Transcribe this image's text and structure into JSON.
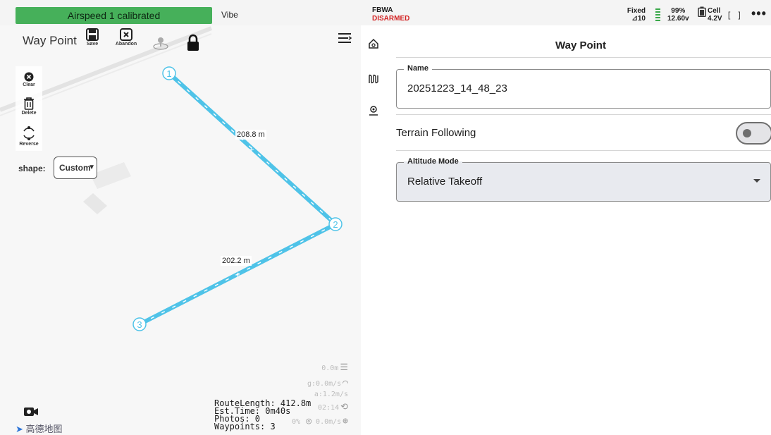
{
  "status": {
    "message": "Airspeed 1 calibrated",
    "vibe_label": "Vibe",
    "flight_mode": "FBWA",
    "arm_state": "DISARMED",
    "gps_fix": "Fixed",
    "gps_sats": "⊿10",
    "battery_percent": "99%",
    "battery_voltage": "12.60v",
    "cell_label": "Cell",
    "cell_voltage": "4.2V",
    "accent_color": "#46b05a",
    "alert_color": "#d22020"
  },
  "map": {
    "title": "Way Point",
    "toolbar": {
      "save_label": "Save",
      "abandon_label": "Abandon"
    },
    "side_tools": {
      "clear_label": "Clear",
      "delete_label": "Delete",
      "reverse_label": "Reverse"
    },
    "shape": {
      "label": "shape:",
      "value": "Custom"
    },
    "waypoints": [
      {
        "label": "1"
      },
      {
        "label": "2"
      },
      {
        "label": "3"
      }
    ],
    "segments": [
      {
        "distance": "208.8 m"
      },
      {
        "distance": "202.2 m"
      }
    ],
    "route_stats": {
      "route_length": "RouteLength: 412.8m",
      "est_time": "Est.Time: 0m40s",
      "photos": "Photos: 0",
      "waypoints": "Waypoints: 3"
    },
    "telemetry": {
      "altitude": "0.0m",
      "ground_speed": "g:0.0m/s",
      "air_speed": "a:1.2m/s",
      "clock": "02:14",
      "throttle": "0%",
      "climb": "0.0m/s"
    },
    "logo_text": "高德地图",
    "route_color": "#4fc3e8"
  },
  "form": {
    "title": "Way Point",
    "name": {
      "label": "Name",
      "value": "20251223_14_48_23"
    },
    "terrain_following": {
      "label": "Terrain Following",
      "enabled": false
    },
    "altitude_mode": {
      "label": "Altitude Mode",
      "value": "Relative Takeoff"
    }
  }
}
